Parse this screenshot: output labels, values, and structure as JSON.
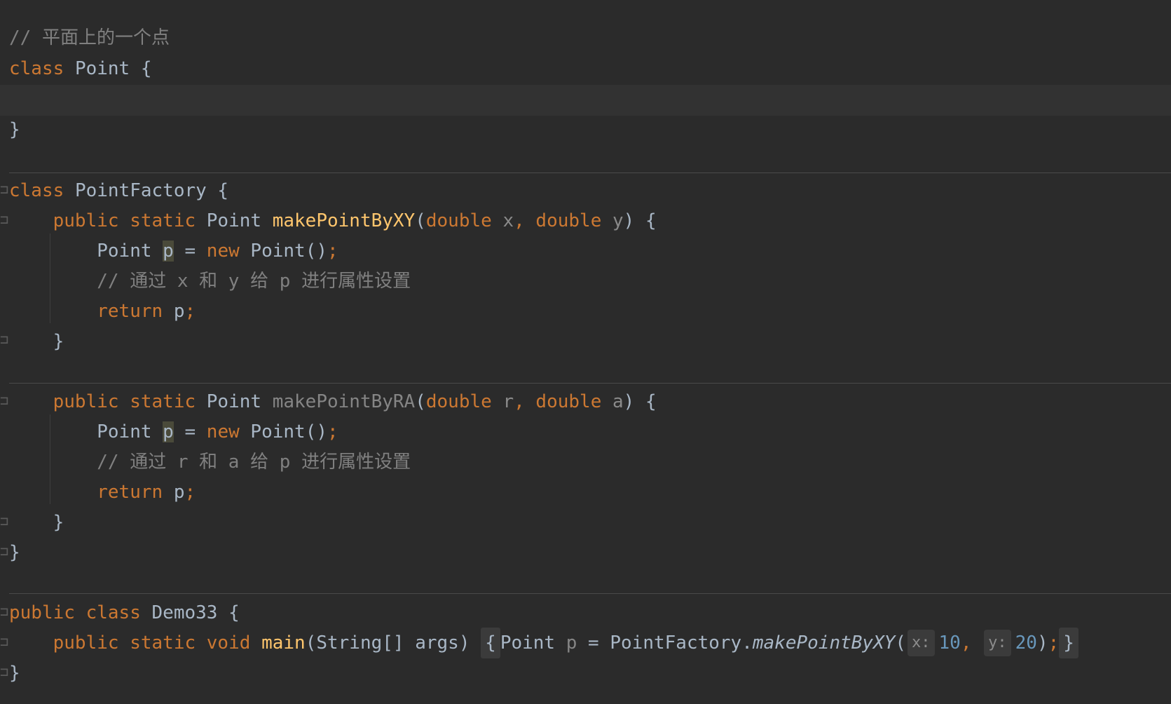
{
  "comment_point": "// 平面上的一个点",
  "kw_class": "class",
  "kw_public": "public",
  "kw_static": "static",
  "kw_void": "void",
  "kw_new": "new",
  "kw_return": "return",
  "kw_double": "double",
  "cls_point": "Point",
  "cls_factory": "PointFactory",
  "cls_demo": "Demo33",
  "fn_xy": "makePointByXY",
  "fn_ra": "makePointByRA",
  "fn_main": "main",
  "comment_xy": "// 通过 x 和 y 给 p 进行属性设置",
  "comment_ra": "// 通过 r 和 a 给 p 进行属性设置",
  "param_x": "x",
  "param_y": "y",
  "param_r": "r",
  "param_a": "a",
  "var_p": "p",
  "main_args": "(String[] args)",
  "hint_x": "x:",
  "hint_y": "y:",
  "arg_10": "10",
  "arg_20": "20"
}
